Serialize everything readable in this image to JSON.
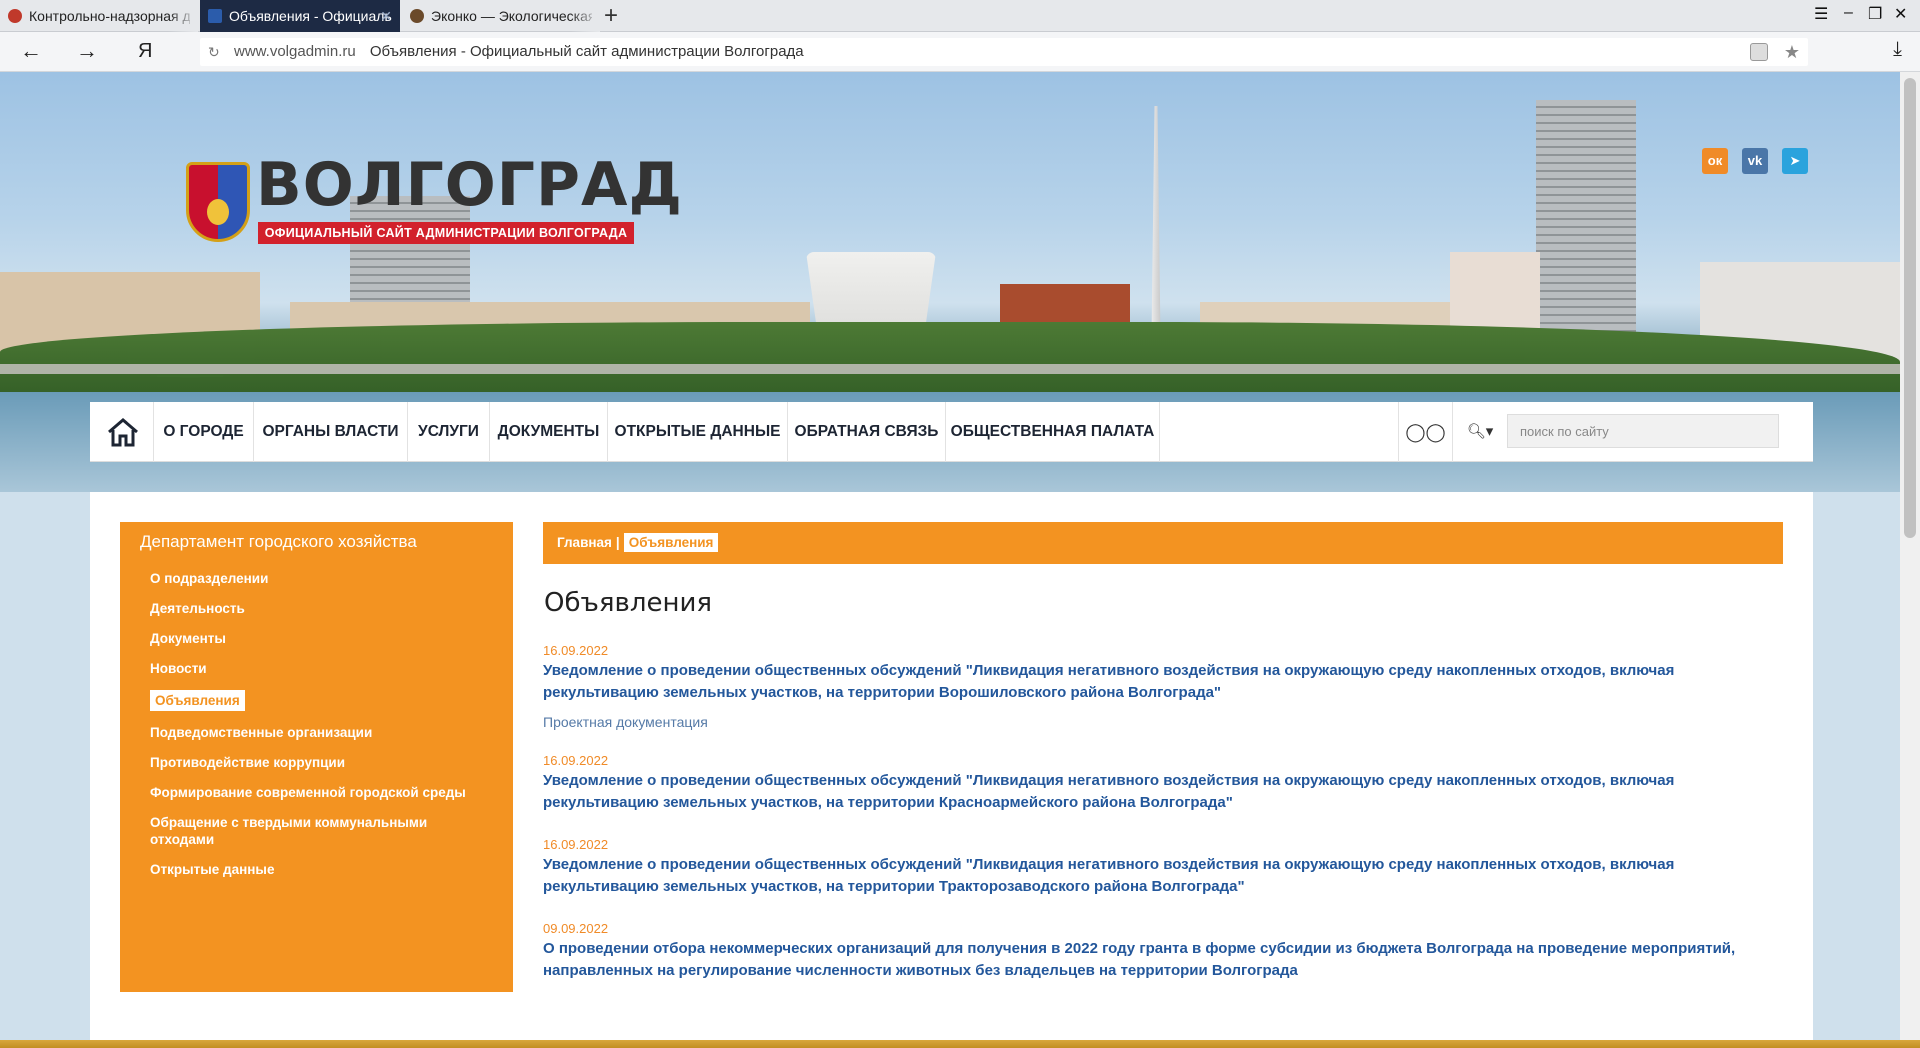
{
  "browser": {
    "tabs": [
      {
        "title": "Контрольно-надзорная де",
        "favicon_color": "#c0392b",
        "active": false
      },
      {
        "title": "Объявления - Официаль",
        "favicon_color": "#2b5cab",
        "active": true
      },
      {
        "title": "Эконко — Экологическая з",
        "favicon_color": "#6b4a2a",
        "active": false
      }
    ],
    "new_tab": "+",
    "address": {
      "domain": "www.volgadmin.ru",
      "page_title": "Объявления - Официальный сайт администрации Волгограда"
    }
  },
  "header": {
    "logo_title": "ВОЛГОГРАД",
    "logo_subtitle": "ОФИЦИАЛЬНЫЙ САЙТ АДМИНИСТРАЦИИ ВОЛГОГРАДА",
    "social": [
      {
        "name": "odnoklassniki",
        "glyph": "ок",
        "color": "#f08b28"
      },
      {
        "name": "vkontakte",
        "glyph": "vk",
        "color": "#4a76a8"
      },
      {
        "name": "telegram",
        "glyph": "➤",
        "color": "#2aa3dd"
      }
    ]
  },
  "mainnav": {
    "items": [
      "О ГОРОДЕ",
      "ОРГАНЫ ВЛАСТИ",
      "УСЛУГИ",
      "ДОКУМЕНТЫ",
      "ОТКРЫТЫЕ ДАННЫЕ",
      "ОБРАТНАЯ СВЯЗЬ",
      "ОБЩЕСТВЕННАЯ ПАЛАТА"
    ],
    "search_placeholder": "поиск по сайту"
  },
  "sidebar": {
    "title": "Департамент городского хозяйства",
    "items": [
      "О подразделении",
      "Деятельность",
      "Документы",
      "Новости",
      "Объявления",
      "Подведомственные организации",
      "Противодействие коррупции",
      "Формирование современной городской среды",
      "Обращение с твердыми коммунальными отходами",
      "Открытые данные"
    ],
    "active_index": 4
  },
  "breadcrumbs": {
    "home": "Главная",
    "separator": "|",
    "current": "Объявления"
  },
  "page_title": "Объявления",
  "news": [
    {
      "date": "16.09.2022",
      "title": "Уведомление о проведении общественных обсуждений \"Ликвидация негативного воздействия на окружающую среду накопленных отходов, включая рекультивацию земельных участков, на территории Ворошиловского района Волгограда\"",
      "doc": "Проектная документация"
    },
    {
      "date": "16.09.2022",
      "title": "Уведомление о проведении общественных обсуждений \"Ликвидация негативного воздействия на окружающую среду накопленных отходов, включая рекультивацию земельных участков, на территории Красноармейского района Волгограда\""
    },
    {
      "date": "16.09.2022",
      "title": "Уведомление о проведении общественных обсуждений \"Ликвидация негативного воздействия на окружающую среду накопленных отходов, включая рекультивацию земельных участков, на территории Тракторозаводского района Волгограда\""
    },
    {
      "date": "09.09.2022",
      "title": "О проведении отбора некоммерческих организаций для получения в 2022 году гранта в форме субсидии из бюджета Волгограда на проведение мероприятий, направленных на регулирование численности животных без владельцев на территории Волгограда"
    }
  ],
  "colors": {
    "accent_orange": "#f39321",
    "link_blue": "#23579b",
    "logo_red": "#d2212c",
    "active_tab": "#1d2a44"
  }
}
